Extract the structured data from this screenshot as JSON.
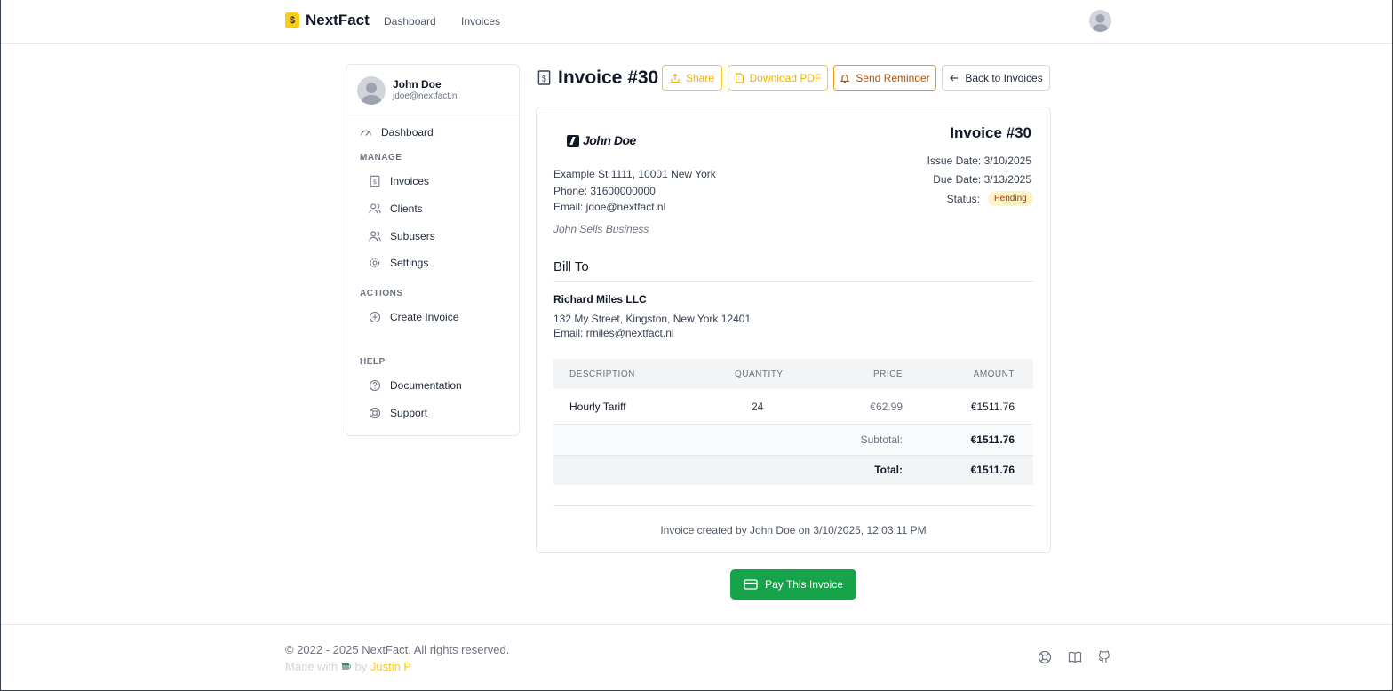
{
  "app": {
    "brand": "NextFact"
  },
  "topnav": {
    "links": [
      "Dashboard",
      "Invoices"
    ]
  },
  "user": {
    "name": "John Doe",
    "email": "jdoe@nextfact.nl"
  },
  "sidebar": {
    "dashboard": "Dashboard",
    "sections": {
      "manage": "MANAGE",
      "actions": "ACTIONS",
      "help": "HELP"
    },
    "manage_items": [
      "Invoices",
      "Clients",
      "Subusers",
      "Settings"
    ],
    "action_items": [
      "Create Invoice"
    ],
    "help_items": [
      "Documentation",
      "Support"
    ]
  },
  "header": {
    "title": "Invoice #30",
    "share": "Share",
    "download": "Download PDF",
    "reminder": "Send Reminder",
    "back": "Back to Invoices"
  },
  "invoice": {
    "logo_text": "John Doe",
    "address": "Example St 1111, 10001 New York",
    "phone": "Phone: 31600000000",
    "email": "Email: jdoe@nextfact.nl",
    "business": "John Sells Business",
    "title": "Invoice #30",
    "issue_label": "Issue Date:",
    "issue_date": "3/10/2025",
    "due_label": "Due Date:",
    "due_date": "3/13/2025",
    "status_label": "Status:",
    "status": "Pending",
    "bill_to": "Bill To",
    "client": {
      "name": "Richard Miles LLC",
      "address": "132 My Street, Kingston, New York 12401",
      "email": "Email: rmiles@nextfact.nl"
    },
    "columns": [
      "DESCRIPTION",
      "QUANTITY",
      "PRICE",
      "AMOUNT"
    ],
    "items": [
      {
        "description": "Hourly Tariff",
        "quantity": "24",
        "price": "€62.99",
        "amount": "€1511.76"
      }
    ],
    "subtotal_label": "Subtotal:",
    "subtotal": "€1511.76",
    "total_label": "Total:",
    "total": "€1511.76",
    "created": "Invoice created by John Doe on 3/10/2025, 12:03:11 PM"
  },
  "pay_button": "Pay This Invoice",
  "footer": {
    "copyright": "© 2022 - 2025 NextFact. All rights reserved.",
    "made_with": "Made with",
    "by": "by",
    "author": "Justin P"
  },
  "colors": {
    "accent": "#facc15",
    "pay": "#16a34a",
    "badge_bg": "#fef3c7",
    "badge_text": "#92400e"
  }
}
